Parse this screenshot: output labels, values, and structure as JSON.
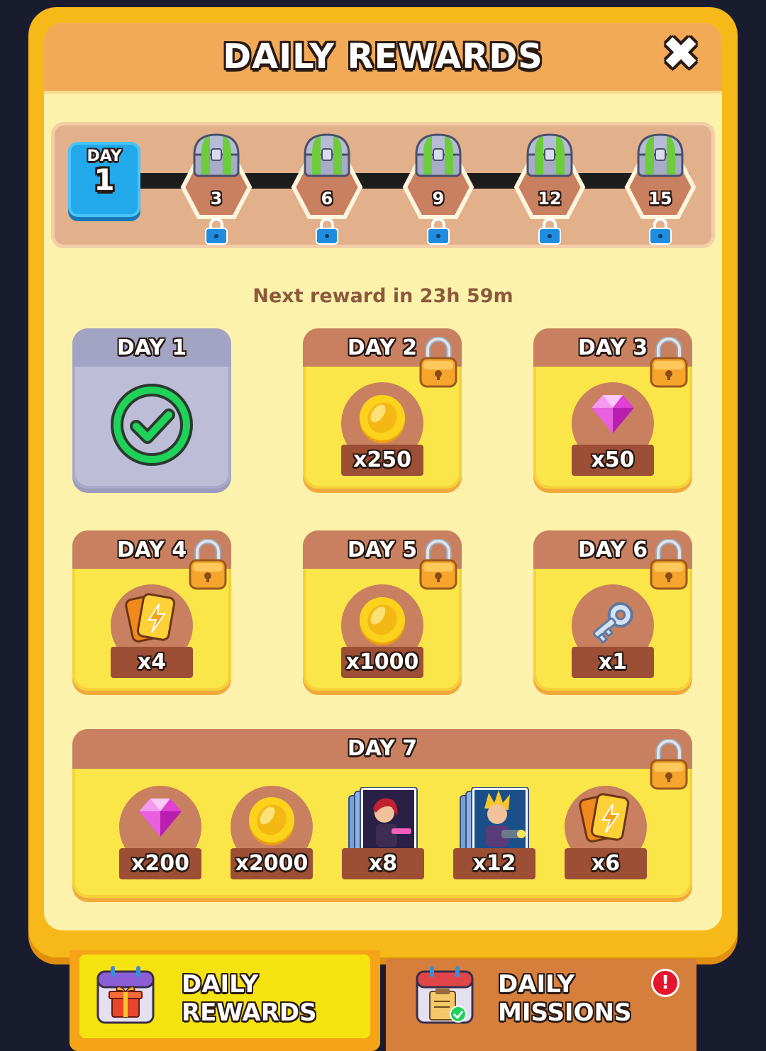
{
  "title": "DAILY REWARDS",
  "close_icon": "close-icon",
  "streak": {
    "current_label": "DAY",
    "current_day": "1",
    "milestones": [
      "3",
      "6",
      "9",
      "12",
      "15"
    ]
  },
  "next_reward": "Next reward in 23h 59m",
  "days": [
    {
      "label": "DAY 1",
      "status": "claimed"
    },
    {
      "label": "DAY 2",
      "reward": "coin",
      "qty": "x250",
      "status": "locked"
    },
    {
      "label": "DAY 3",
      "reward": "gem",
      "qty": "x50",
      "status": "locked"
    },
    {
      "label": "DAY 4",
      "reward": "energy-card",
      "qty": "x4",
      "status": "locked"
    },
    {
      "label": "DAY 5",
      "reward": "coin",
      "qty": "x1000",
      "status": "locked"
    },
    {
      "label": "DAY 6",
      "reward": "key",
      "qty": "x1",
      "status": "locked"
    }
  ],
  "day7": {
    "label": "DAY 7",
    "items": [
      {
        "reward": "gem",
        "qty": "x200"
      },
      {
        "reward": "coin",
        "qty": "x2000"
      },
      {
        "reward": "hero-card-red",
        "qty": "x8"
      },
      {
        "reward": "hero-card-blue",
        "qty": "x12"
      },
      {
        "reward": "energy-card",
        "qty": "x6"
      }
    ]
  },
  "tabs": {
    "rewards_line1": "DAILY",
    "rewards_line2": "REWARDS",
    "missions_line1": "DAILY",
    "missions_line2": "MISSIONS",
    "alert": "!"
  },
  "colors": {
    "panel": "#f7b81a",
    "header": "#f2aa57",
    "day_badge": "#22a9ec",
    "card_header": "#c98060",
    "qty_bar": "#9c4f35",
    "check": "#1fd35a",
    "alert": "#e5152d"
  }
}
